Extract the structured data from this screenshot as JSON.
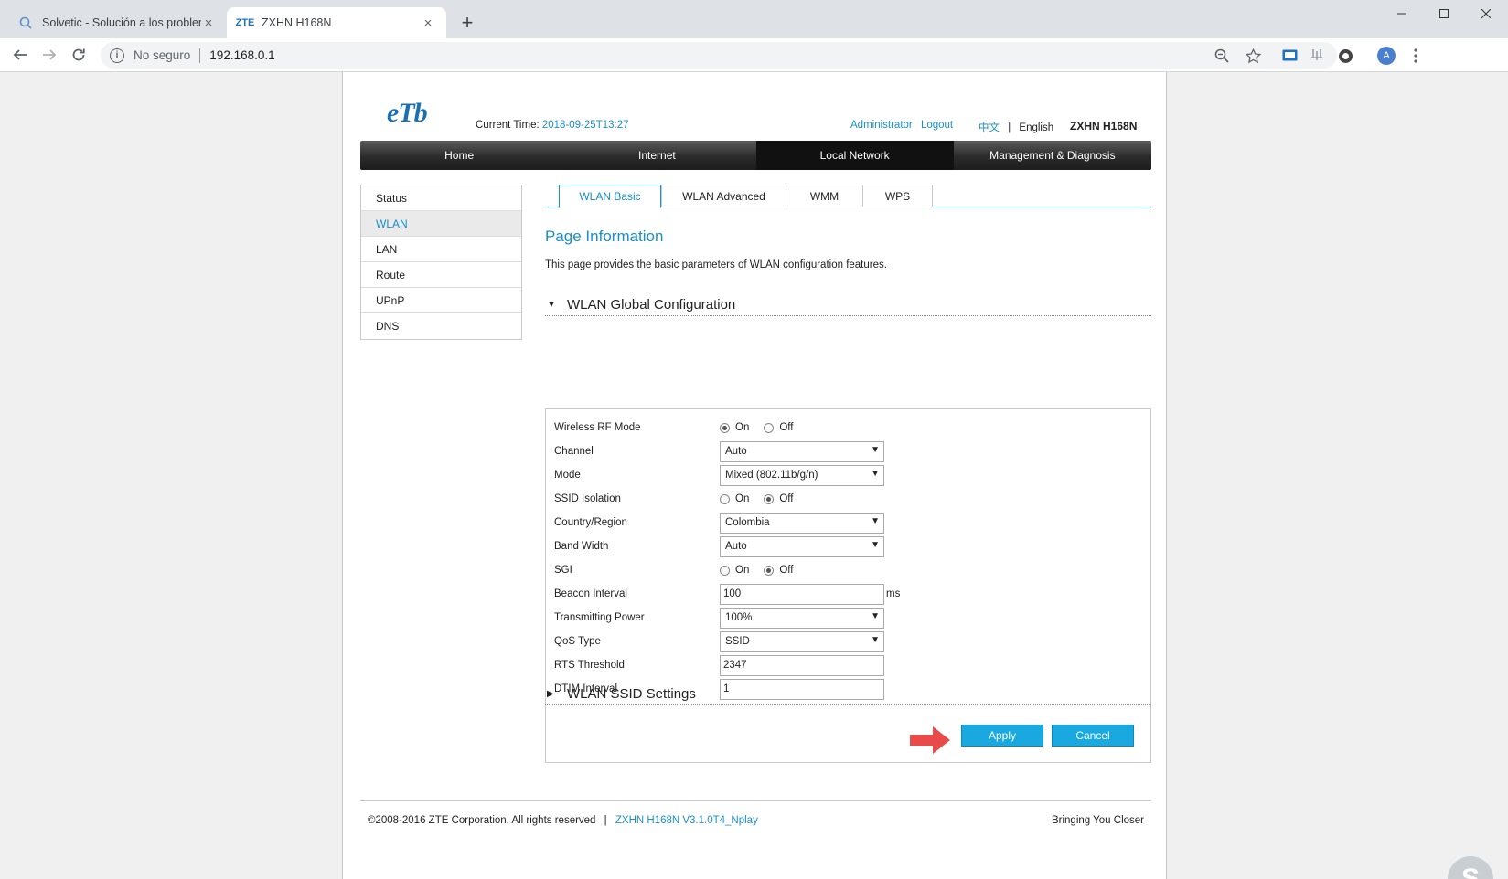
{
  "browser": {
    "tabs": [
      {
        "title": "Solvetic - Solución a los problem",
        "favicon": "search-icon"
      },
      {
        "title": "ZXHN H168N",
        "favicon": "ZTE"
      }
    ],
    "security": "No seguro",
    "url": "192.168.0.1",
    "profile_initial": "A"
  },
  "header": {
    "logo": "eTb",
    "current_time_label": "Current Time:",
    "current_time_value": "2018-09-25T13:27",
    "admin": "Administrator",
    "logout": "Logout",
    "lang_zh": "中文",
    "lang_sep": "|",
    "lang_en": "English",
    "model": "ZXHN H168N"
  },
  "mainnav": [
    "Home",
    "Internet",
    "Local Network",
    "Management & Diagnosis"
  ],
  "mainnav_selected": "Local Network",
  "sidenav": [
    "Status",
    "WLAN",
    "LAN",
    "Route",
    "UPnP",
    "DNS"
  ],
  "sidenav_selected": "WLAN",
  "subtabs": [
    "WLAN Basic",
    "WLAN Advanced",
    "WMM",
    "WPS"
  ],
  "subtab_selected": "WLAN Basic",
  "page_info": {
    "title": "Page Information",
    "description": "This page provides the basic parameters of WLAN configuration features."
  },
  "global_section": {
    "title": "WLAN Global Configuration",
    "fields": {
      "rf_mode": {
        "label": "Wireless RF Mode",
        "on": "On",
        "off": "Off",
        "value": "On"
      },
      "channel": {
        "label": "Channel",
        "value": "Auto"
      },
      "mode": {
        "label": "Mode",
        "value": "Mixed (802.11b/g/n)"
      },
      "ssid_isolation": {
        "label": "SSID Isolation",
        "on": "On",
        "off": "Off",
        "value": "Off"
      },
      "country": {
        "label": "Country/Region",
        "value": "Colombia"
      },
      "bandwidth": {
        "label": "Band Width",
        "value": "Auto"
      },
      "sgi": {
        "label": "SGI",
        "on": "On",
        "off": "Off",
        "value": "Off"
      },
      "beacon": {
        "label": "Beacon Interval",
        "value": "100",
        "unit": "ms"
      },
      "tx_power": {
        "label": "Transmitting Power",
        "value": "100%"
      },
      "qos": {
        "label": "QoS Type",
        "value": "SSID"
      },
      "rts": {
        "label": "RTS Threshold",
        "value": "2347"
      },
      "dtim": {
        "label": "DTIM Interval",
        "value": "1"
      }
    },
    "apply": "Apply",
    "cancel": "Cancel"
  },
  "ssid_section": {
    "title": "WLAN SSID Settings"
  },
  "footer": {
    "copyright": "©2008-2016 ZTE Corporation. All rights reserved",
    "sep": "|",
    "version": "ZXHN H168N V3.1.0T4_Nplay",
    "tagline": "Bringing You Closer"
  },
  "colors": {
    "accent": "#1a8fc8",
    "button": "#19a8e0",
    "annotation_arrow": "#e94b4b"
  }
}
